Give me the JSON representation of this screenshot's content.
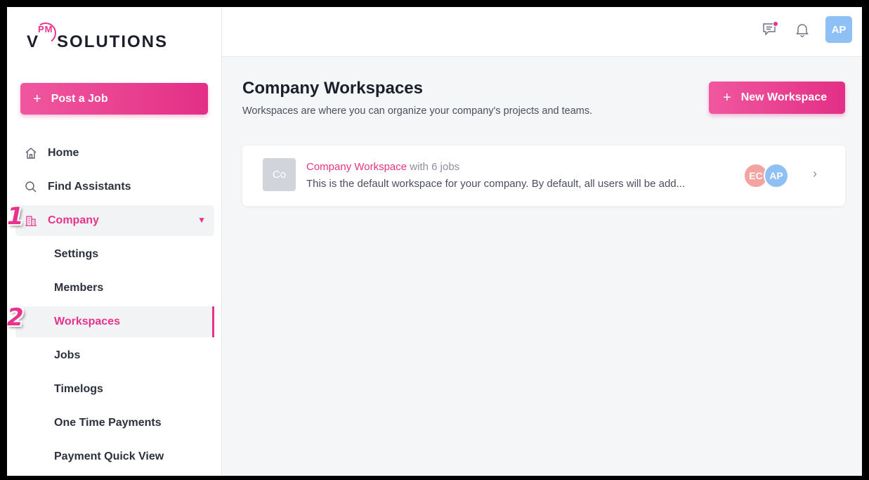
{
  "brand": {
    "v": "V",
    "pm": "PM",
    "name": "SOLUTIONS"
  },
  "sidebar": {
    "post_job": "Post a Job",
    "items": [
      {
        "label": "Home",
        "icon": "home-icon"
      },
      {
        "label": "Find Assistants",
        "icon": "search-icon"
      },
      {
        "label": "Company",
        "icon": "building-icon"
      }
    ],
    "company_subitems": [
      "Settings",
      "Members",
      "Workspaces",
      "Jobs",
      "Timelogs",
      "One Time Payments",
      "Payment Quick View"
    ]
  },
  "markers": [
    "1",
    "2"
  ],
  "topbar": {
    "avatar": "AP"
  },
  "main": {
    "title": "Company Workspaces",
    "subtitle": "Workspaces are where you can organize your company's projects and teams.",
    "new_button": "New Workspace",
    "workspace": {
      "thumb": "Co",
      "name": "Company Workspace",
      "jobs": "with 6 jobs",
      "description": "This is the default workspace for your company. By default, all users will be add...",
      "members": [
        "EC",
        "AP"
      ]
    }
  },
  "colors": {
    "accent": "#e8338a",
    "avatar_blue": "#8ec0f5",
    "avatar_salmon": "#f5a3a0"
  }
}
